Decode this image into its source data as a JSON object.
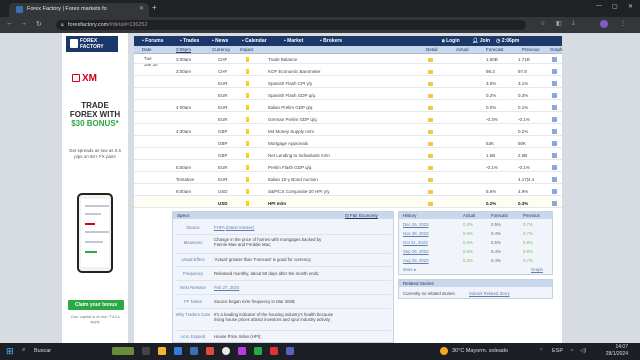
{
  "browser": {
    "tab_title": "Forex Factory | Forex markets fo",
    "url_domain": "forexfactory.com",
    "url_path": "/#detail=136252"
  },
  "site": {
    "logo_line1": "FOREX",
    "logo_line2": "FACTORY",
    "nav": [
      "Forums",
      "Trades",
      "News",
      "Calendar",
      "Market",
      "Brokers"
    ],
    "login": "Login",
    "join": "Join",
    "time": "2:06pm"
  },
  "ad": {
    "brand": "XM",
    "headline1": "TRADE",
    "headline2": "FOREX WITH",
    "headline3": "$30 BONUS*",
    "sub": "Get spreads as low as 0.6 pips on 50+ FX pairs",
    "cta": "Claim your bonus",
    "risk": "Your capital is at risk *T&Cs apply"
  },
  "calendar": {
    "headers": {
      "date": "Date",
      "time": "2:06pm",
      "currency": "Currency",
      "impact": "Impact",
      "detail": "Detail",
      "actual": "Actual",
      "forecast": "Forecast",
      "previous": "Previous",
      "graph": "Graph"
    },
    "date_label_day": "Tue",
    "date_label_date": "Jan 30",
    "rows": [
      {
        "time": "2:00am",
        "cur": "CHF",
        "title": "Trade Balance",
        "actual": "",
        "forecast": "1.50B",
        "previous": "1.71B",
        "impact": "yellow"
      },
      {
        "time": "3:00am",
        "cur": "CHF",
        "title": "KOF Economic Barometer",
        "actual": "",
        "forecast": "98.3",
        "previous": "97.8",
        "impact": "yellow"
      },
      {
        "time": "",
        "cur": "EUR",
        "title": "Spanish Flash CPI y/y",
        "actual": "",
        "forecast": "3.0%",
        "previous": "3.1%",
        "impact": "yellow"
      },
      {
        "time": "",
        "cur": "EUR",
        "title": "Spanish Flash GDP q/q",
        "actual": "",
        "forecast": "0.2%",
        "previous": "0.3%",
        "impact": "yellow"
      },
      {
        "time": "4:00am",
        "cur": "EUR",
        "title": "Italian Prelim GDP q/q",
        "actual": "",
        "forecast": "0.0%",
        "previous": "0.1%",
        "impact": "yellow"
      },
      {
        "time": "",
        "cur": "EUR",
        "title": "German Prelim GDP q/q",
        "actual": "",
        "forecast": "-0.3%",
        "previous": "-0.1%",
        "impact": "yellow"
      },
      {
        "time": "4:30am",
        "cur": "GBP",
        "title": "M4 Money Supply m/m",
        "actual": "",
        "forecast": "",
        "previous": "0.2%",
        "impact": "yellow"
      },
      {
        "time": "",
        "cur": "GBP",
        "title": "Mortgage Approvals",
        "actual": "",
        "forecast": "53K",
        "previous": "50K",
        "impact": "yellow"
      },
      {
        "time": "",
        "cur": "GBP",
        "title": "Net Lending to Individuals m/m",
        "actual": "",
        "forecast": "1.5B",
        "previous": "2.0B",
        "impact": "yellow"
      },
      {
        "time": "5:00am",
        "cur": "EUR",
        "title": "Prelim Flash GDP q/q",
        "actual": "",
        "forecast": "-0.1%",
        "previous": "-0.1%",
        "impact": "yellow"
      },
      {
        "time": "Tentative",
        "cur": "EUR",
        "title": "Italian 10-y Bond Auction",
        "actual": "",
        "forecast": "",
        "previous": "4.17|4.4",
        "impact": "yellow"
      },
      {
        "time": "9:00am",
        "cur": "USD",
        "title": "S&P/CS Composite-20 HPI y/y",
        "actual": "",
        "forecast": "5.6%",
        "previous": "4.9%",
        "impact": "yellow"
      },
      {
        "time": "",
        "cur": "USD",
        "title": "HPI m/m",
        "actual": "",
        "forecast": "0.2%",
        "previous": "0.3%",
        "impact": "yellow",
        "highlight": true
      }
    ]
  },
  "details": {
    "specs_label": "Specs",
    "fair_economy": "Fair Economy",
    "source_label": "Source",
    "source_link": "FHFA",
    "source_latest": "(latest release)",
    "measures_label": "Measures",
    "measures": "Change in the price of homes with mortgages backed by Fannie Mae and Freddie Mac;",
    "usual_effect_label": "Usual Effect",
    "usual_effect": "'Actual' greater than 'Forecast' is good for currency;",
    "frequency_label": "Frequency",
    "frequency": "Released monthly, about 60 days after the month ends;",
    "next_release_label": "Next Release",
    "next_release": "Feb 27, 2024",
    "ff_notes_label": "FF Notes",
    "ff_notes": "Source began m/m frequency in Mar 2008;",
    "why_label": "Why Traders Care",
    "why": "It's a leading indicator of the housing industry's health because rising house prices attract investors and spur industry activity;",
    "acro_label": "Acro Expand",
    "acro": "House Price Index (HPI);"
  },
  "history": {
    "title": "History",
    "headers": [
      "Actual",
      "Forecast",
      "Previous"
    ],
    "rows": [
      {
        "date": "Dec 26, 2023",
        "actual": "0.3%",
        "forecast": "0.5%",
        "previous": "0.7%"
      },
      {
        "date": "Nov 28, 2023",
        "actual": "0.6%",
        "forecast": "0.4%",
        "previous": "0.7%"
      },
      {
        "date": "Oct 31, 2023",
        "actual": "0.6%",
        "forecast": "0.5%",
        "previous": "0.8%"
      },
      {
        "date": "Sep 26, 2023",
        "actual": "0.8%",
        "forecast": "0.4%",
        "previous": "0.8%"
      },
      {
        "date": "Aug 29, 2023",
        "actual": "0.3%",
        "forecast": "0.4%",
        "previous": "0.7%"
      }
    ],
    "more": "More",
    "graph": "Graph"
  },
  "stories": {
    "title": "Related Stories",
    "none": "Currently no related stories.",
    "submit": "Submit Related Story"
  },
  "taskbar": {
    "search": "Buscar",
    "weather": "30°C  Mayorm. soleado",
    "lang": "ESP",
    "time": "14:07",
    "date": "28/1/2024"
  },
  "colors": {
    "brand_navy": "#1b3868",
    "header_blue": "#c9d7ea",
    "impact_yellow": "#f5d11c",
    "impact_orange": "#f08a24",
    "xm_red": "#d0001f",
    "bonus_green": "#2aa846"
  }
}
